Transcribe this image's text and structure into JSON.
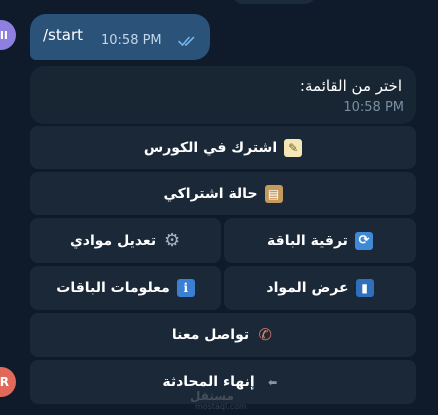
{
  "avatars": {
    "left_initial": "II",
    "bottom_initial": "R"
  },
  "outgoing": {
    "text": "/start",
    "time": "10:58 PM",
    "status_icon": "double-check-icon"
  },
  "incoming": {
    "text": "اختر من القائمة:",
    "time": "10:58 PM"
  },
  "keyboard": {
    "subscribe": {
      "label": "اشترك في الكورس",
      "icon": "memo-icon",
      "glyph": "✎"
    },
    "status": {
      "label": "حالة اشتراكي",
      "icon": "clipboard-icon",
      "glyph": "▤"
    },
    "upgrade": {
      "label": "ترقية الباقة",
      "icon": "cycle-arrows-icon",
      "glyph": "⟳"
    },
    "edit_subjects": {
      "label": "تعديل موادي",
      "icon": "gear-icon",
      "glyph": "⚙"
    },
    "view_subjects": {
      "label": "عرض المواد",
      "icon": "book-icon",
      "glyph": "▮"
    },
    "plan_info": {
      "label": "معلومات الباقات",
      "icon": "info-icon",
      "glyph": "i"
    },
    "contact": {
      "label": "تواصل معنا",
      "icon": "phone-icon",
      "glyph": "✆"
    },
    "end": {
      "label": "إنهاء المحادثة",
      "icon": "end-arrow-icon",
      "glyph": "⬅"
    }
  },
  "watermark": {
    "text": "مستقل",
    "sub": "mostaql.com"
  },
  "colors": {
    "background": "#0f1b2a",
    "outgoing_bubble": "#2b5278",
    "incoming_bubble": "#182533",
    "keyboard_button": "#1a2838",
    "check_color": "#6fb3ef"
  }
}
